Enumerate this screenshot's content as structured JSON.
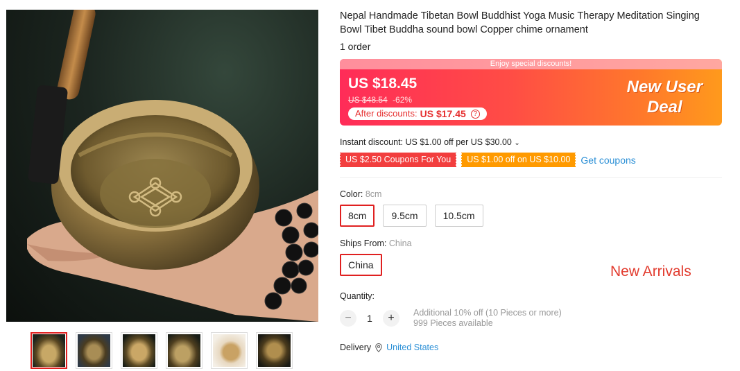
{
  "product": {
    "title": "Nepal Handmade Tibetan Bowl Buddhist Yoga Music Therapy Meditation Singing Bowl Tibet Buddha sound bowl Copper chime ornament",
    "orders": "1 order"
  },
  "gallery": {
    "main_image_icon": "singing-bowl-photo",
    "thumbnails": [
      "thumb-1",
      "thumb-2",
      "thumb-3",
      "thumb-4",
      "thumb-5",
      "thumb-6"
    ],
    "active_index": 0
  },
  "price": {
    "banner": "Enjoy special discounts!",
    "current": "US $18.45",
    "original": "US $48.54",
    "discount": "-62%",
    "after_label": "After discounts:",
    "after_value": "US $17.45",
    "deal_line1": "New User",
    "deal_line2": "Deal"
  },
  "discounts": {
    "instant": "Instant discount: US $1.00 off per US $30.00",
    "coupon_1": "US $2.50 Coupons For You",
    "coupon_2": "US $1.00 off on US $10.00",
    "get_coupons": "Get coupons"
  },
  "color": {
    "label": "Color:",
    "selected": "8cm",
    "options": [
      "8cm",
      "9.5cm",
      "10.5cm"
    ]
  },
  "ships_from": {
    "label": "Ships From:",
    "selected": "China",
    "options": [
      "China"
    ]
  },
  "overlay_text": "New Arrivals",
  "quantity": {
    "label": "Quantity:",
    "minus": "−",
    "value": "1",
    "plus": "+",
    "note_1": "Additional 10% off (10 Pieces or more)",
    "note_2": "999 Pieces available"
  },
  "delivery": {
    "label": "Delivery",
    "location": "United States"
  },
  "colors": {
    "accent_red": "#e02020",
    "link_blue": "#2a8fd6",
    "coupon_orange": "#ff9a00"
  }
}
